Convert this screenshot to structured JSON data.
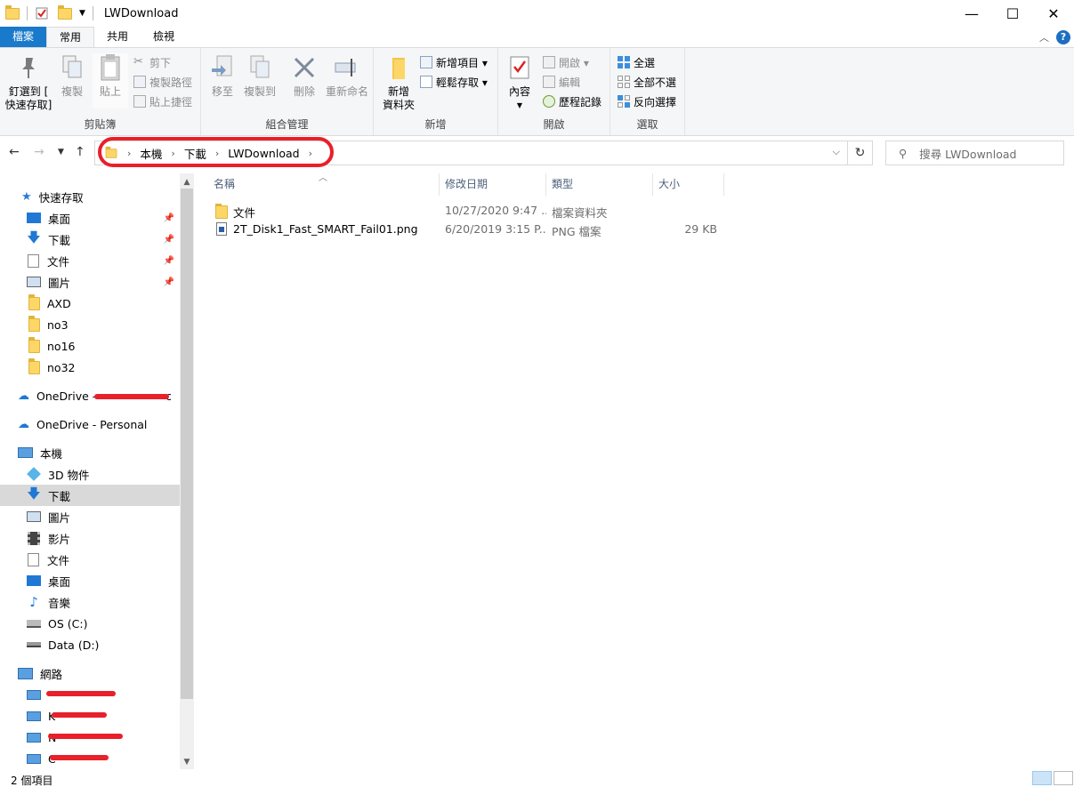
{
  "window": {
    "title": "LWDownload",
    "controls": {
      "minimize": "—",
      "maximize": "☐",
      "close": "✕"
    }
  },
  "ribbon_tabs": [
    "檔案",
    "常用",
    "共用",
    "檢視"
  ],
  "ribbon": {
    "clipboard": {
      "label": "剪貼簿",
      "pin_line1": "釘選到 [",
      "pin_line2": "快速存取]",
      "copy": "複製",
      "paste": "貼上",
      "cut": "剪下",
      "copy_path": "複製路徑",
      "paste_shortcut": "貼上捷徑"
    },
    "organize": {
      "label": "組合管理",
      "move_to": "移至",
      "copy_to": "複製到",
      "delete": "刪除",
      "rename": "重新命名"
    },
    "new": {
      "label": "新增",
      "new_folder_line1": "新增",
      "new_folder_line2": "資料夾",
      "new_item": "新增項目 ▾",
      "easy_access": "輕鬆存取 ▾"
    },
    "open": {
      "label": "開啟",
      "properties": "內容",
      "open": "開啟 ▾",
      "edit": "編輯",
      "history": "歷程記錄"
    },
    "select": {
      "label": "選取",
      "select_all": "全選",
      "select_none": "全部不選",
      "invert": "反向選擇"
    }
  },
  "address": {
    "crumbs": [
      "本機",
      "下載",
      "LWDownload"
    ],
    "search_placeholder": "搜尋 LWDownload"
  },
  "nav_pane": {
    "quick_access": "快速存取",
    "quick_items": [
      "桌面",
      "下載",
      "文件",
      "圖片",
      "AXD",
      "no3",
      "no16",
      "no32"
    ],
    "onedrive_business": "OneDrive - ",
    "onedrive_business_suffix": "c",
    "onedrive_personal": "OneDrive - Personal",
    "this_pc": "本機",
    "pc_items": [
      "3D 物件",
      "下載",
      "圖片",
      "影片",
      "文件",
      "桌面",
      "音樂",
      "OS (C:)",
      "Data (D:)"
    ],
    "network": "網路",
    "network_items": [
      "",
      "K",
      "N",
      "C"
    ]
  },
  "file_list": {
    "columns": [
      "名稱",
      "修改日期",
      "類型",
      "大小"
    ],
    "rows": [
      {
        "name": "文件",
        "date": "10/27/2020 9:47 ...",
        "type": "檔案資料夾",
        "size": ""
      },
      {
        "name": "2T_Disk1_Fast_SMART_Fail01.png",
        "date": "6/20/2019 3:15 P...",
        "type": "PNG 檔案",
        "size": "29 KB"
      }
    ]
  },
  "status": {
    "item_count": "2 個項目"
  },
  "colors": {
    "file_tab": "#1979ca",
    "highlight_circle": "#e8202a",
    "folder": "#fcd667",
    "selected_nav": "#d9d9d9"
  }
}
